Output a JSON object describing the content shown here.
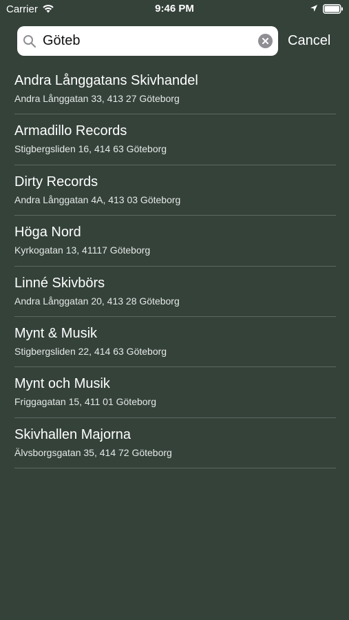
{
  "status_bar": {
    "carrier": "Carrier",
    "time": "9:46 PM",
    "icons": [
      "wifi-icon",
      "location-icon",
      "battery-icon"
    ]
  },
  "search": {
    "value": "Göteb",
    "cancel_label": "Cancel",
    "icons": [
      "search-icon",
      "clear-icon"
    ]
  },
  "colors": {
    "background": "#34423a",
    "separator": "#5d6a63",
    "text": "#ffffff"
  },
  "results": [
    {
      "name": "Andra Långgatans Skivhandel",
      "address": "Andra Långgatan 33, 413 27 Göteborg"
    },
    {
      "name": "Armadillo Records",
      "address": "Stigbergsliden 16, 414 63 Göteborg"
    },
    {
      "name": "Dirty Records",
      "address": "Andra Långgatan 4A, 413 03 Göteborg"
    },
    {
      "name": "Höga Nord",
      "address": "Kyrkogatan 13, 41117 Göteborg"
    },
    {
      "name": "Linné Skivbörs",
      "address": "Andra Långgatan 20, 413 28 Göteborg"
    },
    {
      "name": "Mynt & Musik",
      "address": "Stigbergsliden 22, 414 63 Göteborg"
    },
    {
      "name": "Mynt och Musik",
      "address": "Friggagatan 15, 411 01 Göteborg"
    },
    {
      "name": "Skivhallen Majorna",
      "address": "Älvsborgsgatan 35, 414 72 Göteborg"
    }
  ]
}
